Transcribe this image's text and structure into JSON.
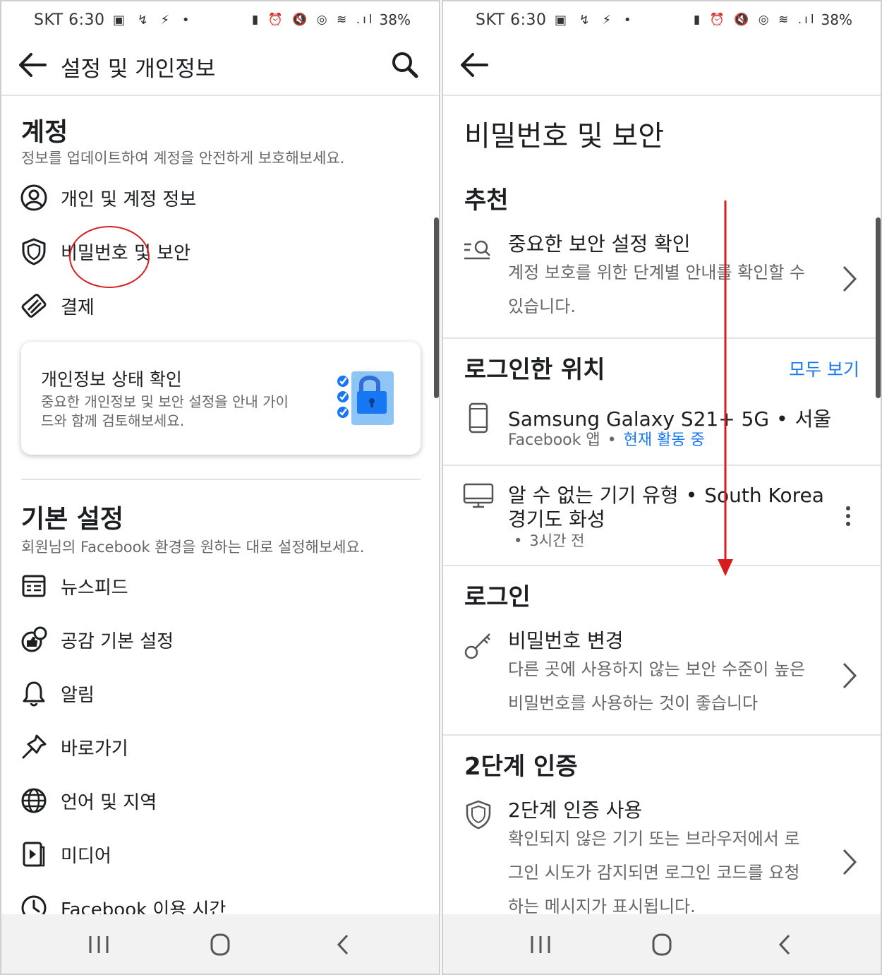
{
  "status_bar": {
    "carrier_time": "SKT 6:30",
    "battery": "38%"
  },
  "left": {
    "appbar": {
      "title": "설정 및 개인정보"
    },
    "account": {
      "title": "계정",
      "subtitle": "정보를 업데이트하여 계정을 안전하게 보호해보세요.",
      "items": [
        {
          "icon": "profile-icon",
          "label": "개인 및 계정 정보"
        },
        {
          "icon": "shield-icon",
          "label": "비밀번호 및 보안"
        },
        {
          "icon": "card-icon",
          "label": "결제"
        }
      ]
    },
    "privacy_card": {
      "title": "개인정보 상태 확인",
      "desc": "중요한 개인정보 및 보안 설정을 안내 가이드와 함께 검토해보세요."
    },
    "preferences": {
      "title": "기본 설정",
      "subtitle": "회원님의 Facebook 환경을 원하는 대로 설정해보세요.",
      "items": [
        {
          "icon": "newsfeed-icon",
          "label": "뉴스피드"
        },
        {
          "icon": "reactions-icon",
          "label": "공감 기본 설정"
        },
        {
          "icon": "bell-icon",
          "label": "알림"
        },
        {
          "icon": "pin-icon",
          "label": "바로가기"
        },
        {
          "icon": "globe-icon",
          "label": "언어 및 지역"
        },
        {
          "icon": "media-icon",
          "label": "미디어"
        },
        {
          "icon": "clock-icon",
          "label": "Facebook 이용 시간"
        }
      ]
    }
  },
  "right": {
    "page_title": "비밀번호 및 보안",
    "recommended": {
      "title": "추천",
      "item_title": "중요한 보안 설정 확인",
      "item_desc": "계정 보호를 위한 단계별 안내를 확인할 수 있습니다."
    },
    "where_logged_in": {
      "title": "로그인한 위치",
      "see_all": "모두 보기",
      "devices": [
        {
          "name": "Samsung Galaxy S21+ 5G",
          "location": "서울",
          "app": "Facebook 앱",
          "status": "현재 활동 중"
        },
        {
          "name": "알 수 없는 기기 유형",
          "location": "South Korea",
          "location2": "경기도 화성",
          "time": "3시간 전"
        }
      ]
    },
    "login": {
      "title": "로그인",
      "item_title": "비밀번호 변경",
      "item_desc": "다른 곳에 사용하지 않는 보안 수준이 높은 비밀번호를 사용하는 것이 좋습니다"
    },
    "two_factor": {
      "title": "2단계 인증",
      "item_title": "2단계 인증 사용",
      "item_desc": "확인되지 않은 기기 또는 브라우저에서 로그인 시도가 감지되면 로그인 코드를 요청하는 메시지가 표시됩니다."
    }
  },
  "colors": {
    "accent": "#1877f2",
    "annotation": "#d61e1e"
  }
}
